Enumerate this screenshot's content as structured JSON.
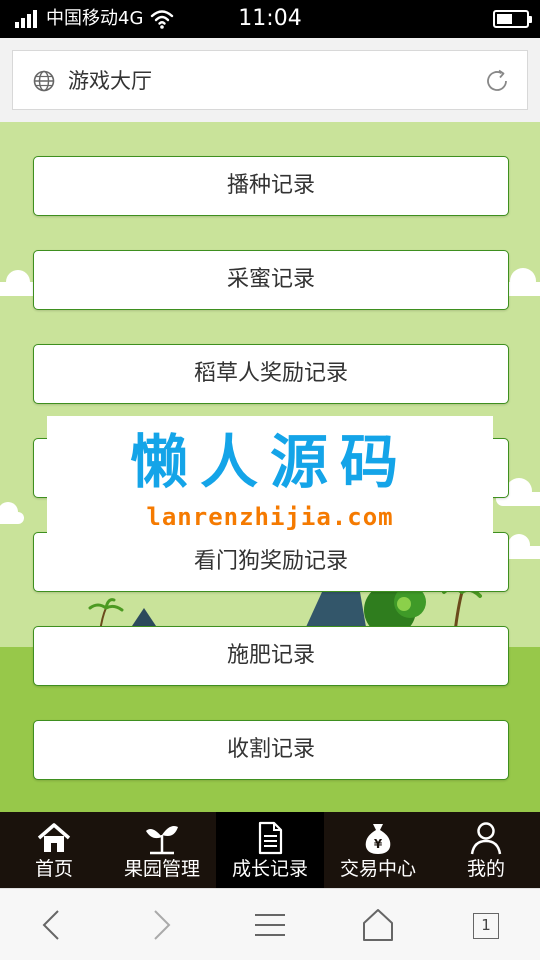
{
  "status_bar": {
    "carrier": "中国移动4G",
    "time": "11:04",
    "battery_level": 0.55
  },
  "address_bar": {
    "title": "游戏大厅",
    "icons": [
      "globe-icon",
      "refresh-icon"
    ]
  },
  "menu": {
    "items": [
      "播种记录",
      "采蜜记录",
      "稻草人奖励记录",
      "",
      "看门狗奖励记录",
      "施肥记录",
      "收割记录"
    ]
  },
  "watermark": {
    "title": "懒人源码",
    "url": "lanrenzhijia.com"
  },
  "tab_bar": {
    "active_index": 2,
    "tabs": [
      {
        "label": "首页",
        "icon": "home-icon"
      },
      {
        "label": "果园管理",
        "icon": "sprout-icon"
      },
      {
        "label": "成长记录",
        "icon": "document-icon"
      },
      {
        "label": "交易中心",
        "icon": "money-bag-icon"
      },
      {
        "label": "我的",
        "icon": "user-icon"
      }
    ]
  },
  "browser_bar": {
    "tab_count": "1",
    "icons": [
      "back-icon",
      "forward-icon",
      "menu-icon",
      "home-icon",
      "tabs-icon"
    ]
  },
  "colors": {
    "sky": "#c9e39a",
    "ground": "#97c84a",
    "button_border": "#3e8f1f",
    "tab_bar": "#1a120c",
    "watermark_title": "#14a4e8",
    "watermark_url": "#f57a00"
  }
}
